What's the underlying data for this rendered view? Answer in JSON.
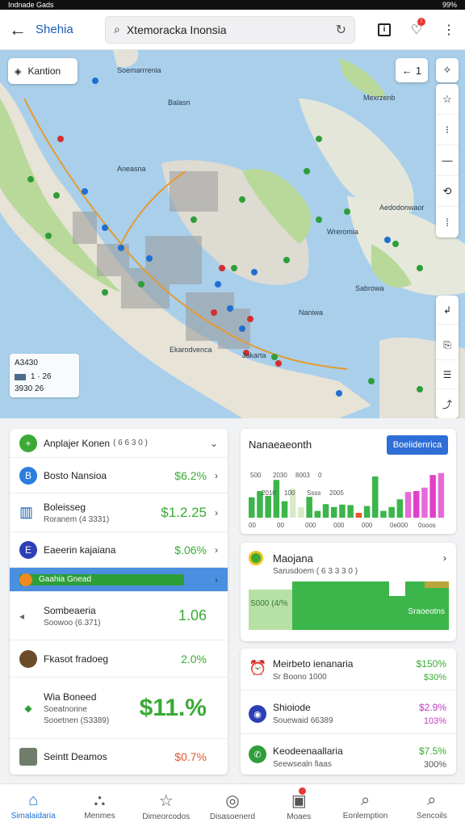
{
  "status": {
    "left": "Indnade Gads",
    "right": "99%"
  },
  "appbar": {
    "title": "Shehia",
    "search_value": "Xtemoracka Inonsia"
  },
  "map": {
    "chip_label": "Kantion",
    "locate_label": "1",
    "legend": {
      "title": "A3430",
      "row1": "1 · 26",
      "row2": "3930 26"
    },
    "labels": [
      "Soemarrrenia",
      "Balasn",
      "Mexrzenb",
      "Aneasna",
      "Aedodonwaor",
      "Wreromia",
      "Naniwa",
      "Ekarodvenca",
      "Jakarta",
      "Sabrowa"
    ]
  },
  "list": {
    "header": {
      "name": "Anplajer Konen",
      "sub": "( 6 6 3 0 )"
    },
    "rows": [
      {
        "name": "Bosto Nansioa",
        "sub": "",
        "value": "$6.2%",
        "color": "#2b7de0",
        "icon": "B"
      },
      {
        "name": "Boleisseg",
        "sub": "Roranem (4 3331)",
        "value": "$1.2.25",
        "color": "#1a5db5",
        "icon": ""
      },
      {
        "name": "Eaeerin kajaiana",
        "sub": "",
        "value": "$.06%",
        "color": "#2c3fb5",
        "icon": "E"
      },
      {
        "name": "Gaahia Gnead",
        "sub": "",
        "value": "",
        "color": "#f08a1c",
        "icon": ""
      },
      {
        "name": "Sombeaeria",
        "sub": "Soowoo (6.371)",
        "value": "1.06",
        "color": "#888",
        "icon": ""
      },
      {
        "name": "Fkasot fradoeg",
        "sub": "",
        "value": "2.0%",
        "color": "#6b4b2a",
        "icon": ""
      },
      {
        "name": "Wia Boneed",
        "sub": "Soeatnorine",
        "sub2": "Sooetnen (S3389)",
        "value": "$11.%",
        "color": "#2e9e3a",
        "icon": ""
      },
      {
        "name": "Seintt Deamos",
        "sub": "",
        "value": "$0.7%",
        "color": "#555",
        "icon": ""
      }
    ]
  },
  "card1": {
    "title": "Nanaeaeonth",
    "button": "Boeiidenrica",
    "tick_labels": [
      "500",
      "2010",
      "2030",
      "100",
      "8003",
      "Ssss",
      "0",
      "2005"
    ],
    "x_labels": [
      "00",
      "00",
      "000",
      "000",
      "000",
      "0e000",
      "0ooos"
    ],
    "bar_heights_pct": [
      42,
      55,
      45,
      78,
      34,
      60,
      22,
      43,
      14,
      28,
      22,
      27,
      26,
      10,
      24,
      85,
      14,
      22,
      38,
      53,
      55,
      62,
      88,
      92
    ]
  },
  "card2": {
    "title": "Maojana",
    "sub": "Sarusdoem ( 6 3 3 3 0 )",
    "label_left": "S000 (4/%",
    "label_right": "Sraoeotns"
  },
  "card3": {
    "rows": [
      {
        "name": "Meirbeto ienanaria",
        "sub": "Sr Boono 1000",
        "v1": "$150%",
        "v2": "$30%",
        "c1": "#3aaa35",
        "c2": "#3aaa35",
        "iconColor": "#e07a3a"
      },
      {
        "name": "Shioiode",
        "sub": "Souewaid 66389",
        "v1": "$2.9%",
        "v2": "103%",
        "c1": "#c23ac2",
        "c2": "#c23ac2",
        "iconColor": "#2c3fb5"
      },
      {
        "name": "Keodeenaallaria",
        "sub": "Seewsealn  fiaas",
        "v1": "$7.5%",
        "v2": "300%",
        "c1": "#3aaa35",
        "c2": "#555",
        "iconColor": "#2e9e3a"
      }
    ]
  },
  "tabs": [
    {
      "label": "Simalaidaria",
      "icon": "⌂"
    },
    {
      "label": "Menmes",
      "icon": "⛬"
    },
    {
      "label": "Dimeorcodos",
      "icon": "☆"
    },
    {
      "label": "Disasoenerd",
      "icon": "◎"
    },
    {
      "label": "Moaes",
      "icon": "▣"
    },
    {
      "label": "Eonlemption",
      "icon": "⌕"
    },
    {
      "label": "Sencoils",
      "icon": "⌕"
    }
  ]
}
